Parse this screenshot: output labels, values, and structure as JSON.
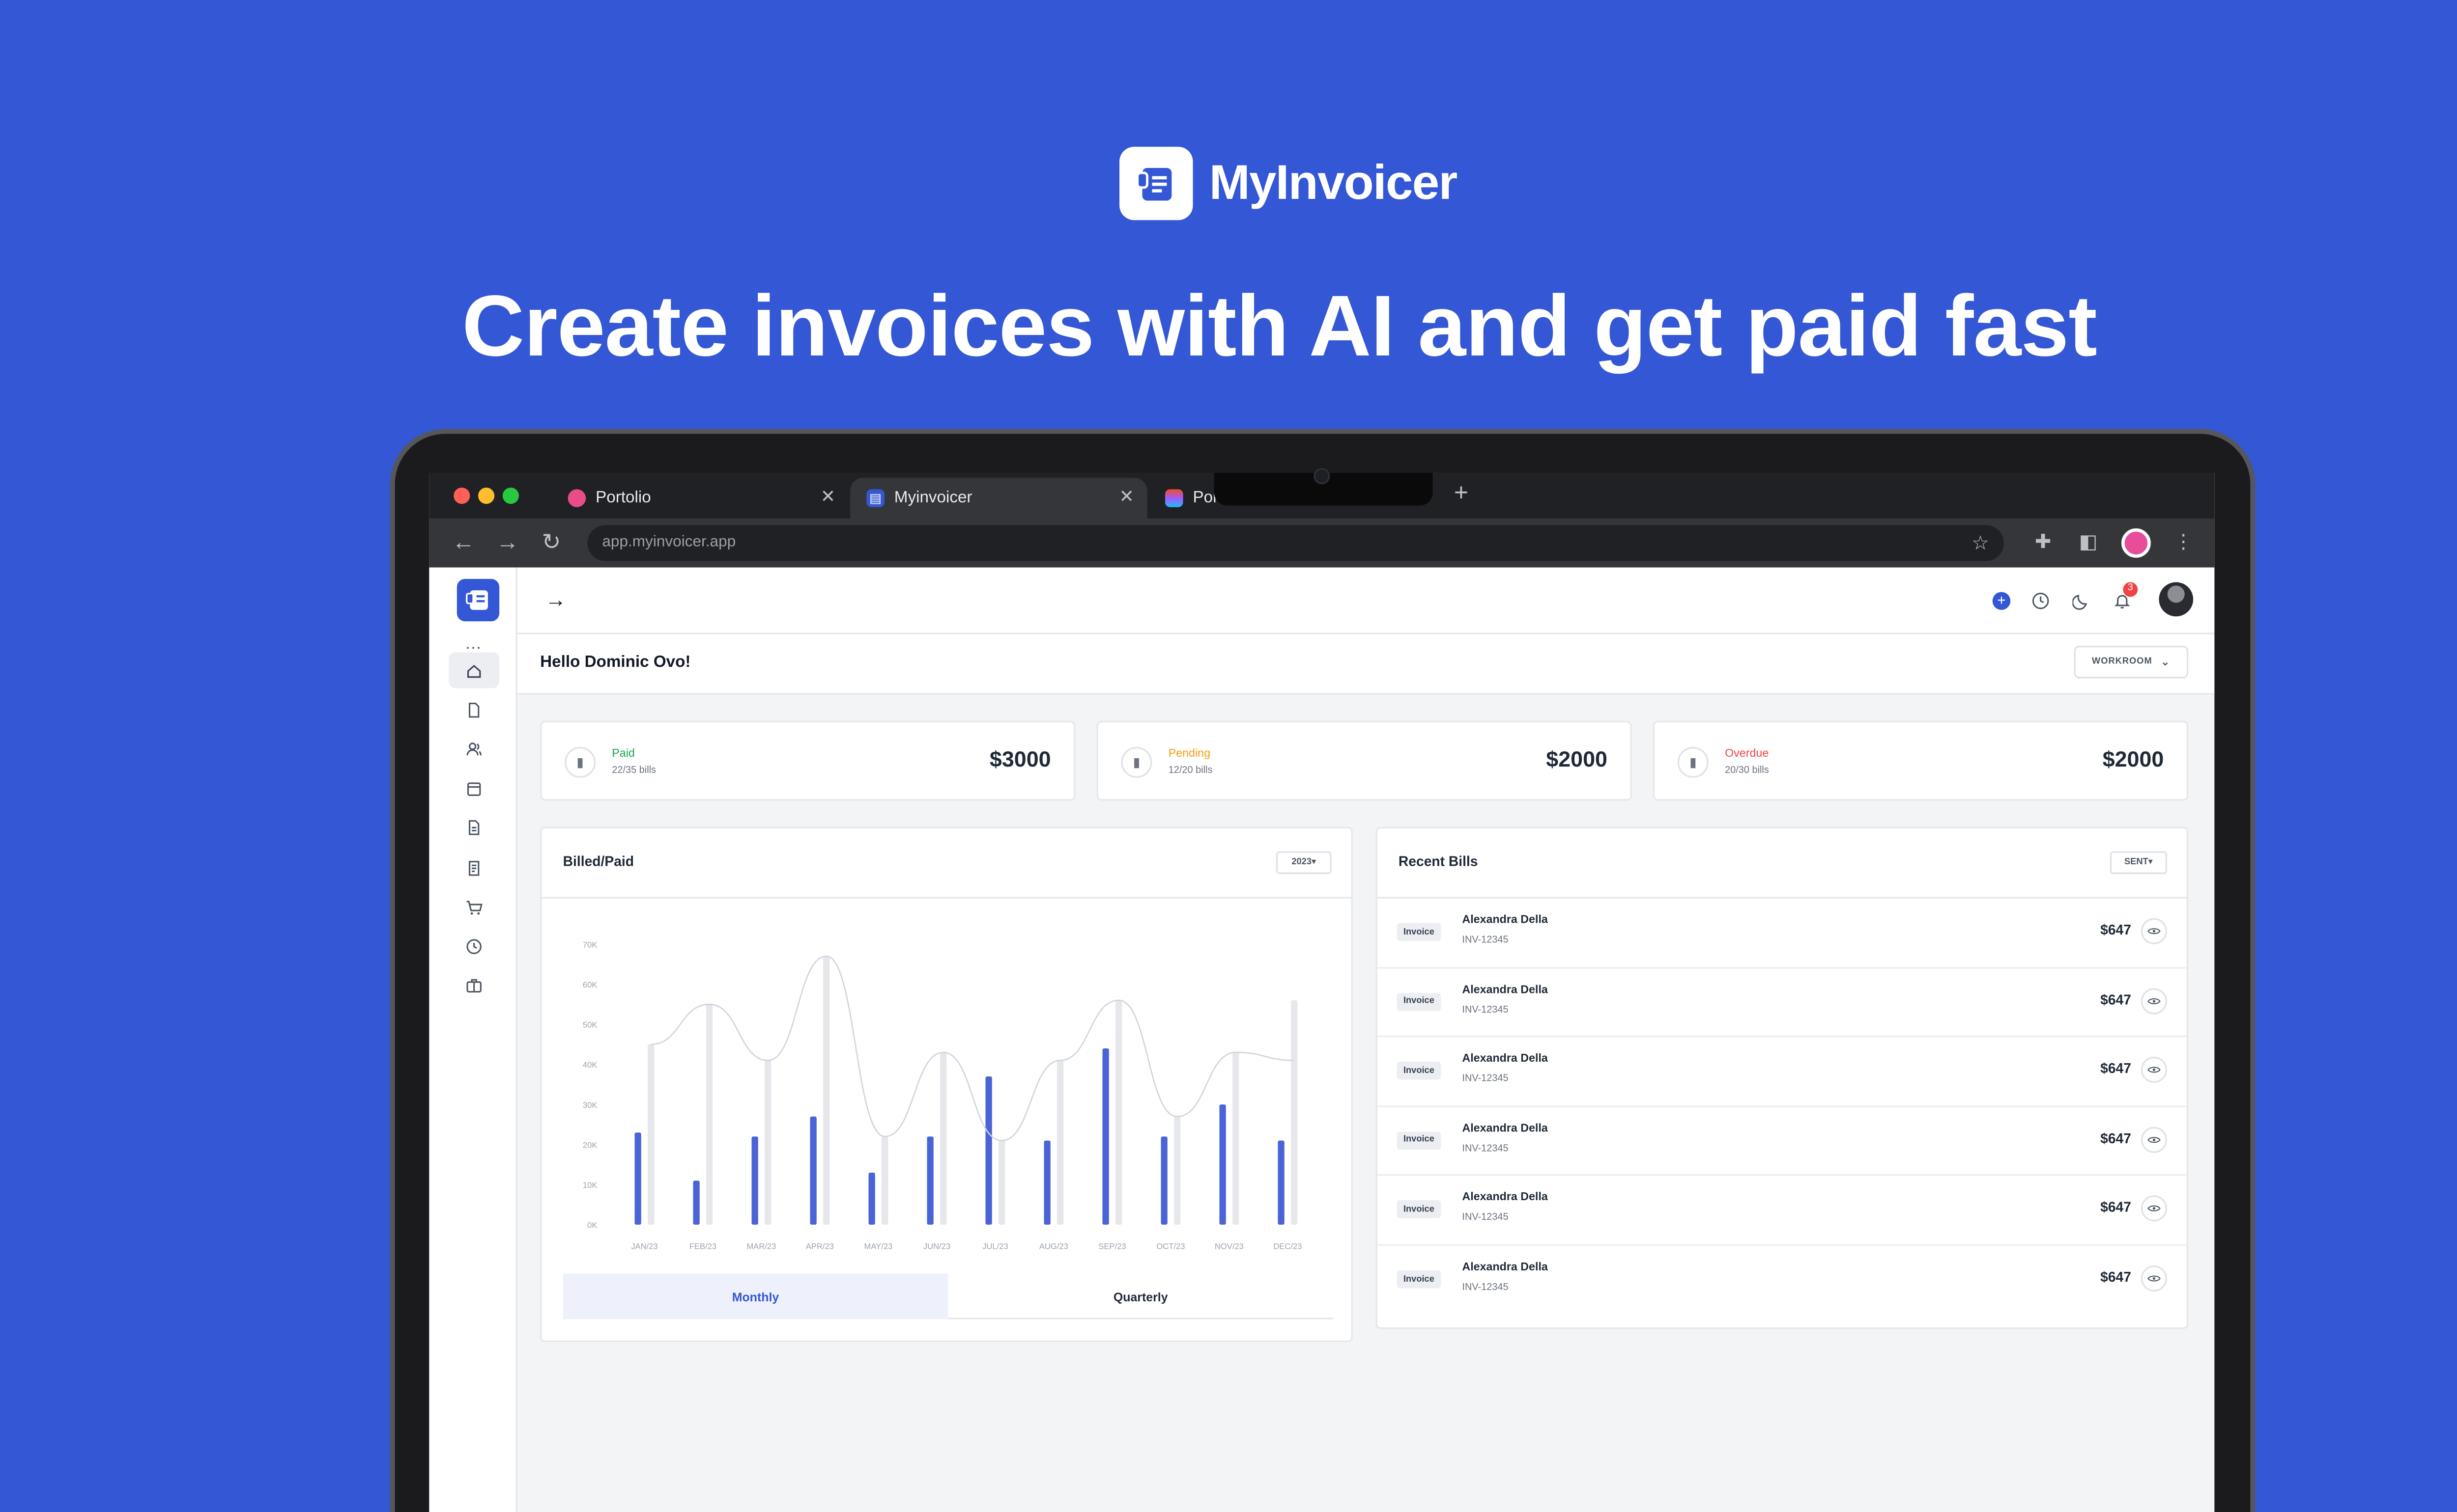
{
  "brand": {
    "name": "MyInvoicer",
    "headline": "Create invoices with AI and get paid fast"
  },
  "browser": {
    "tabs": [
      {
        "title": "Portolio",
        "active": false,
        "favicon": "dribbble-icon",
        "color": "#ea4c89"
      },
      {
        "title": "Myinvoicer",
        "active": true,
        "favicon": "myinvoicer-icon",
        "color": "#3457d5"
      },
      {
        "title": "Por",
        "active": false,
        "favicon": "figma-icon",
        "color": "#f24e1e"
      }
    ],
    "url": "app.myinvoicer.app"
  },
  "app": {
    "greeting": "Hello Dominic Ovo!",
    "workroom_label": "WORKROOM",
    "notification_count": "3",
    "sidebar_icons": [
      "home-icon",
      "document-icon",
      "users-icon",
      "calendar-icon",
      "file-icon",
      "invoice-icon",
      "cart-icon",
      "clock-icon",
      "briefcase-icon"
    ],
    "stats": [
      {
        "label": "Paid",
        "sub": "22/35 bills",
        "value": "$3000",
        "color": "#16a34a"
      },
      {
        "label": "Pending",
        "sub": "12/20 bills",
        "value": "$2000",
        "color": "#f59e0b"
      },
      {
        "label": "Overdue",
        "sub": "20/30 bills",
        "value": "$2000",
        "color": "#ef4444"
      }
    ],
    "billed_paid": {
      "title": "Billed/Paid",
      "year_chip": "2023",
      "tabs": {
        "monthly": "Monthly",
        "quarterly": "Quarterly"
      }
    },
    "recent_bills": {
      "title": "Recent Bills",
      "filter_chip": "SENT",
      "rows": [
        {
          "tag": "Invoice",
          "name": "Alexandra Della",
          "id": "INV-12345",
          "amount": "$647"
        },
        {
          "tag": "Invoice",
          "name": "Alexandra Della",
          "id": "INV-12345",
          "amount": "$647"
        },
        {
          "tag": "Invoice",
          "name": "Alexandra Della",
          "id": "INV-12345",
          "amount": "$647"
        },
        {
          "tag": "Invoice",
          "name": "Alexandra Della",
          "id": "INV-12345",
          "amount": "$647"
        },
        {
          "tag": "Invoice",
          "name": "Alexandra Della",
          "id": "INV-12345",
          "amount": "$647"
        },
        {
          "tag": "Invoice",
          "name": "Alexandra Della",
          "id": "INV-12345",
          "amount": "$647"
        }
      ]
    }
  },
  "chart_data": {
    "type": "bar",
    "title": "Billed/Paid",
    "categories": [
      "JAN/23",
      "FEB/23",
      "MAR/23",
      "APR/23",
      "MAY/23",
      "JUN/23",
      "JUL/23",
      "AUG/23",
      "SEP/23",
      "OCT/23",
      "NOV/23",
      "DEC/23"
    ],
    "y_tick_labels": [
      "0K",
      "10K",
      "20K",
      "30K",
      "40K",
      "50K",
      "60K",
      "70K"
    ],
    "ylim": [
      0,
      70000
    ],
    "series": [
      {
        "values": [
          23000,
          11000,
          22000,
          27000,
          13000,
          22000,
          37000,
          21000,
          44000,
          22000,
          30000,
          21000
        ],
        "color": "#4a63d6"
      },
      {
        "values": [
          45000,
          55000,
          41000,
          67000,
          22000,
          43000,
          21000,
          41000,
          56000,
          27000,
          43000,
          56000
        ],
        "color": "#e5e7eb"
      }
    ],
    "trend_line": [
      45000,
      55000,
      41000,
      67000,
      22000,
      43000,
      21000,
      41000,
      56000,
      27000,
      43000,
      41000
    ],
    "grid": false,
    "legend": "none"
  }
}
